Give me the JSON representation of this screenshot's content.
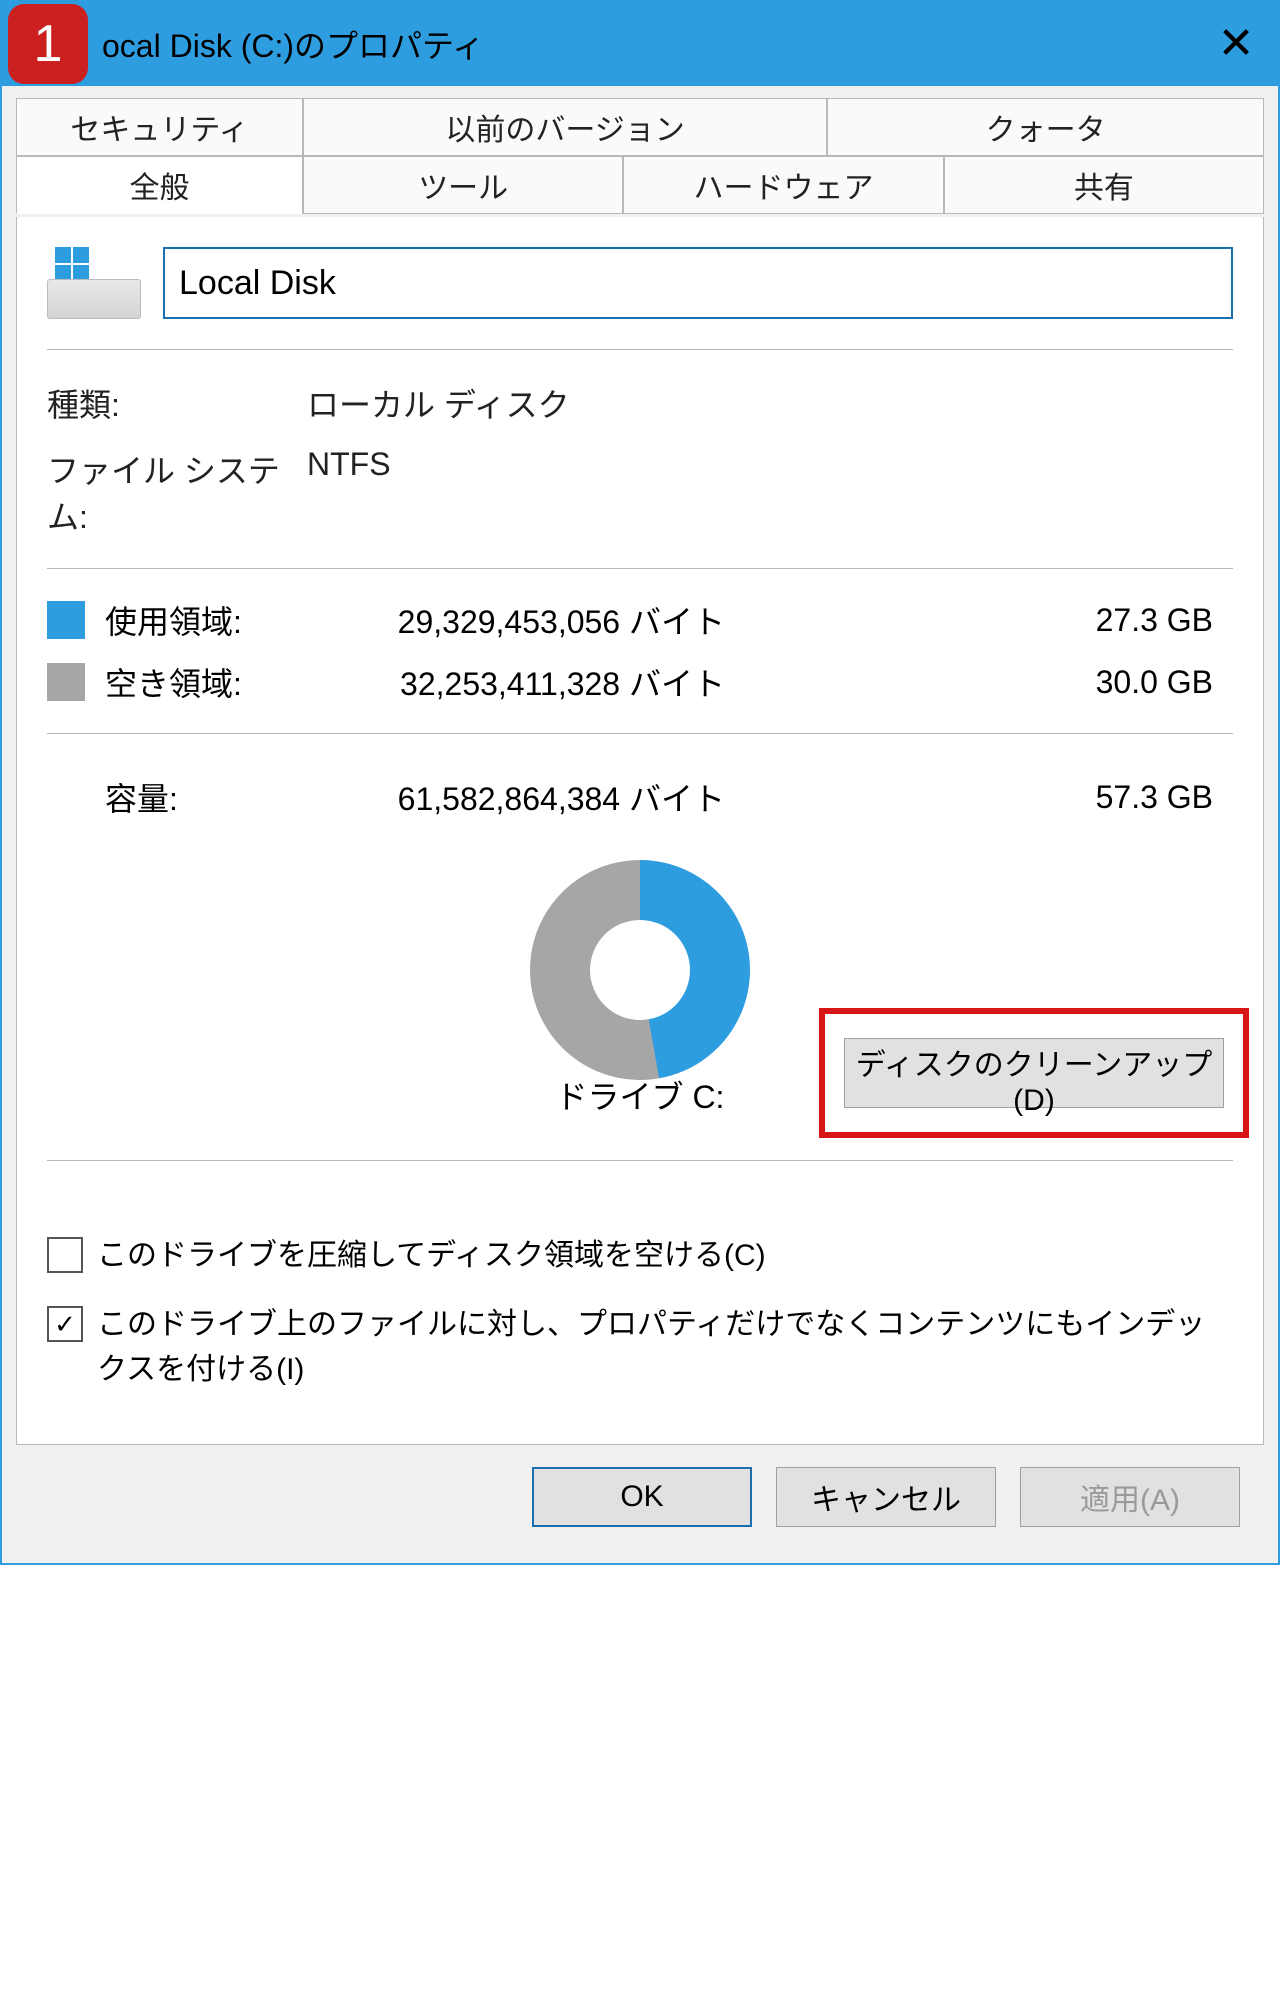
{
  "overlay": {
    "step_number": "1"
  },
  "window": {
    "title": "ocal Disk (C:)のプロパティ",
    "close_glyph": "✕"
  },
  "tabs": {
    "row_top": [
      {
        "label": "セキュリティ"
      },
      {
        "label": "以前のバージョン"
      },
      {
        "label": "クォータ"
      }
    ],
    "row_bottom": [
      {
        "label": "全般",
        "active": true
      },
      {
        "label": "ツール"
      },
      {
        "label": "ハードウェア"
      },
      {
        "label": "共有"
      }
    ]
  },
  "general": {
    "name_value": "Local Disk",
    "type_label": "種類:",
    "type_value": "ローカル ディスク",
    "fs_label": "ファイル システム:",
    "fs_value": "NTFS",
    "used": {
      "label": "使用領域:",
      "bytes": "29,329,453,056 バイト",
      "human": "27.3 GB",
      "color": "#2e9de0"
    },
    "free": {
      "label": "空き領域:",
      "bytes": "32,253,411,328 バイト",
      "human": "30.0 GB",
      "color": "#a6a6a6"
    },
    "capacity": {
      "label": "容量:",
      "bytes": "61,582,864,384 バイト",
      "human": "57.3 GB"
    },
    "drive_label": "ドライブ C:",
    "cleanup_button": "ディスクのクリーンアップ(D)",
    "compress_checkbox": "このドライブを圧縮してディスク領域を空ける(C)",
    "index_checkbox": "このドライブ上のファイルに対し、プロパティだけでなくコンテンツにもインデックスを付ける(I)",
    "index_checked": true
  },
  "buttons": {
    "ok": "OK",
    "cancel": "キャンセル",
    "apply": "適用(A)"
  },
  "chart_data": {
    "type": "pie",
    "title": "ドライブ C:",
    "series": [
      {
        "name": "使用領域",
        "value": 29329453056,
        "human": "27.3 GB",
        "color": "#2e9de0"
      },
      {
        "name": "空き領域",
        "value": 32253411328,
        "human": "30.0 GB",
        "color": "#a6a6a6"
      }
    ],
    "total": {
      "name": "容量",
      "value": 61582864384,
      "human": "57.3 GB"
    }
  }
}
